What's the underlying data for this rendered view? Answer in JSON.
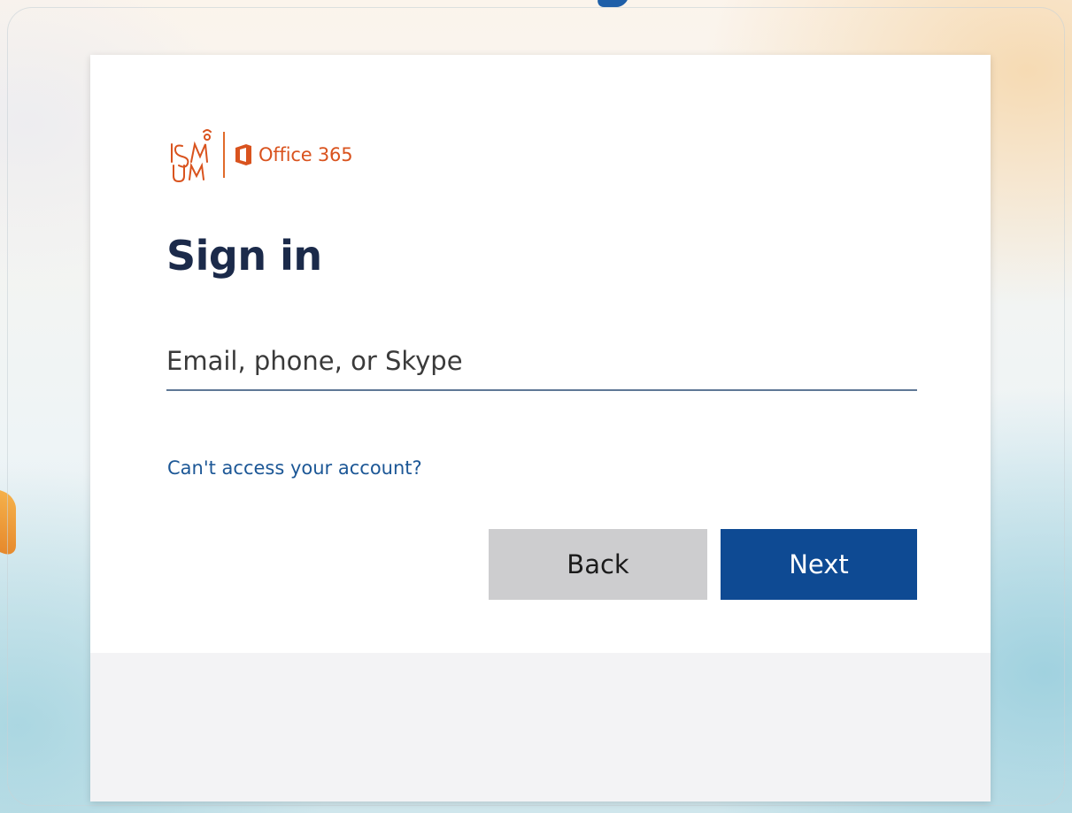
{
  "brand": {
    "org_logo_text": "ISM",
    "product_name": "Office 365",
    "accent_color": "#d9531e"
  },
  "signin": {
    "title": "Sign in",
    "email_placeholder": "Email, phone, or Skype",
    "email_value": "",
    "help_link": "Can't access your account?"
  },
  "buttons": {
    "back_label": "Back",
    "next_label": "Next",
    "next_color": "#0e4a93",
    "back_color": "#cdcdcf"
  },
  "icons": {
    "org_logo": "ism-logo",
    "product_logo": "office-logo-icon"
  }
}
